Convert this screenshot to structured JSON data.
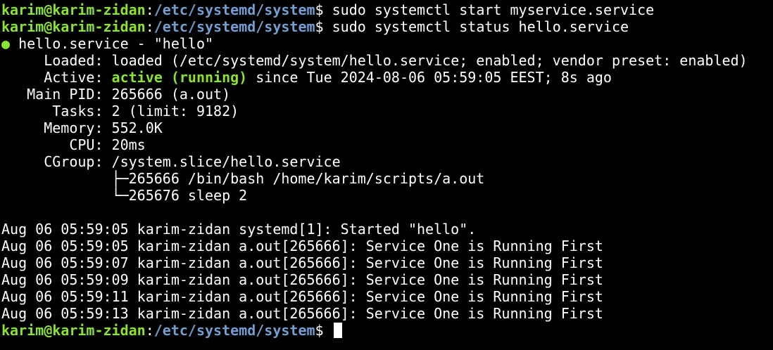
{
  "prompt": {
    "user_host": "karim@karim-zidan",
    "separator": ":",
    "path": "/etc/systemd/system",
    "symbol": "$ "
  },
  "commands": [
    "sudo systemctl start myservice.service",
    "sudo systemctl status hello.service"
  ],
  "status": {
    "bullet": "●",
    "header": " hello.service - \"hello\"",
    "loaded_label": "     Loaded: ",
    "loaded_value": "loaded (/etc/systemd/system/hello.service; enabled; vendor preset: enabled)",
    "active_label": "     Active: ",
    "active_state": "active (running)",
    "active_rest": " since Tue 2024-08-06 05:59:05 EEST; 8s ago",
    "main_pid": "   Main PID: 265666 (a.out)",
    "tasks": "      Tasks: 2 (limit: 9182)",
    "memory": "     Memory: 552.0K",
    "cpu": "        CPU: 20ms",
    "cgroup": "     CGroup: /system.slice/hello.service",
    "cgroup_child_1": "             ├─265666 /bin/bash /home/karim/scripts/a.out",
    "cgroup_child_2": "             └─265676 sleep 2"
  },
  "logs": [
    "Aug 06 05:59:05 karim-zidan systemd[1]: Started \"hello\".",
    "Aug 06 05:59:05 karim-zidan a.out[265666]: Service One is Running First",
    "Aug 06 05:59:07 karim-zidan a.out[265666]: Service One is Running First",
    "Aug 06 05:59:09 karim-zidan a.out[265666]: Service One is Running First",
    "Aug 06 05:59:11 karim-zidan a.out[265666]: Service One is Running First",
    "Aug 06 05:59:13 karim-zidan a.out[265666]: Service One is Running First"
  ],
  "colors": {
    "background": "#000000",
    "prompt_user": "#8ae234",
    "prompt_path": "#729fcf",
    "active_running": "#8ae234",
    "text": "#ffffff"
  }
}
